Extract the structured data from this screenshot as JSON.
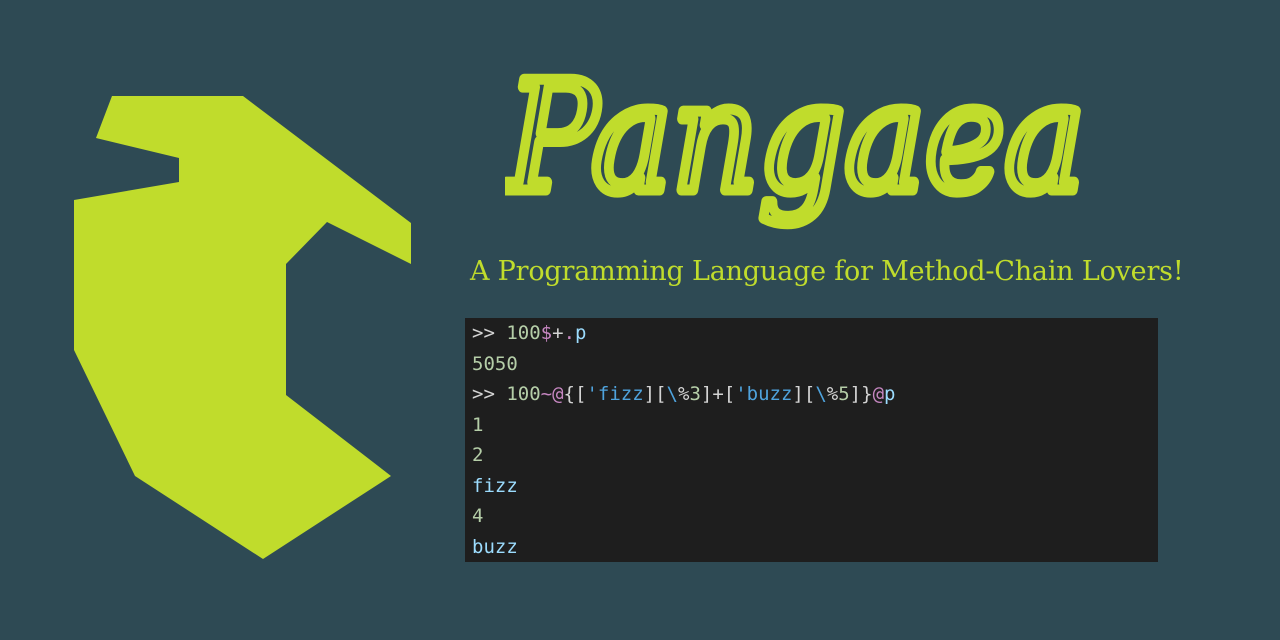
{
  "brand": {
    "name": "Pangaea",
    "tagline": "A Programming Language for Method-Chain Lovers!",
    "accent_color": "#c0dc2c",
    "background_color": "#2e4a54"
  },
  "logo": {
    "icon": "pangaea-continent-logo"
  },
  "terminal": {
    "background_color": "#1e1e1e",
    "lines": [
      {
        "kind": "input",
        "tokens": [
          {
            "t": "prompt",
            "v": ">> "
          },
          {
            "t": "num",
            "v": "100"
          },
          {
            "t": "op",
            "v": "$"
          },
          {
            "t": "plain",
            "v": "+"
          },
          {
            "t": "op",
            "v": "."
          },
          {
            "t": "meth",
            "v": "p"
          }
        ]
      },
      {
        "kind": "output",
        "tokens": [
          {
            "t": "out-num",
            "v": "5050"
          }
        ]
      },
      {
        "kind": "input",
        "tokens": [
          {
            "t": "prompt",
            "v": ">> "
          },
          {
            "t": "num",
            "v": "100"
          },
          {
            "t": "op",
            "v": "~@"
          },
          {
            "t": "bracket",
            "v": "{["
          },
          {
            "t": "str",
            "v": "'fizz"
          },
          {
            "t": "bracket",
            "v": "]["
          },
          {
            "t": "str",
            "v": "\\"
          },
          {
            "t": "plain",
            "v": "%"
          },
          {
            "t": "num",
            "v": "3"
          },
          {
            "t": "bracket",
            "v": "]+["
          },
          {
            "t": "str",
            "v": "'buzz"
          },
          {
            "t": "bracket",
            "v": "]["
          },
          {
            "t": "str",
            "v": "\\"
          },
          {
            "t": "plain",
            "v": "%"
          },
          {
            "t": "num",
            "v": "5"
          },
          {
            "t": "bracket",
            "v": "]}"
          },
          {
            "t": "op",
            "v": "@"
          },
          {
            "t": "meth",
            "v": "p"
          }
        ]
      },
      {
        "kind": "output",
        "tokens": [
          {
            "t": "out-num",
            "v": "1"
          }
        ]
      },
      {
        "kind": "output",
        "tokens": [
          {
            "t": "out-num",
            "v": "2"
          }
        ]
      },
      {
        "kind": "output",
        "tokens": [
          {
            "t": "out-str",
            "v": "fizz"
          }
        ]
      },
      {
        "kind": "output",
        "tokens": [
          {
            "t": "out-num",
            "v": "4"
          }
        ]
      },
      {
        "kind": "output",
        "tokens": [
          {
            "t": "out-str",
            "v": "buzz"
          }
        ]
      }
    ]
  }
}
